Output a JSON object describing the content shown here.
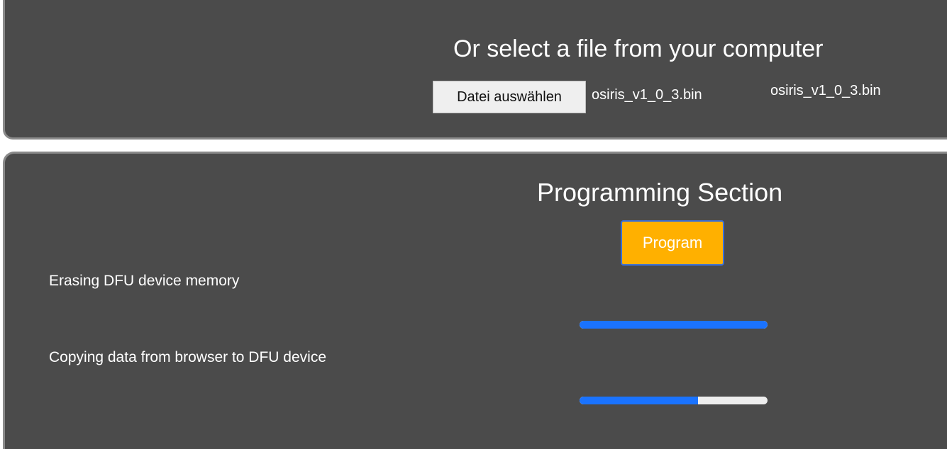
{
  "file_section": {
    "title": "Or select a file from your computer",
    "choose_button_label": "Datei auswählen",
    "selected_file_name": "osiris_v1_0_3.bin",
    "file_label": "osiris_v1_0_3.bin"
  },
  "programming_section": {
    "title": "Programming Section",
    "program_button_label": "Program",
    "erase": {
      "label": "Erasing DFU device memory",
      "progress": 1.0
    },
    "copy": {
      "label": "Copying data from browser to DFU device",
      "progress": 0.63
    }
  },
  "colors": {
    "panel_background": "#4b4b4b",
    "program_button": "#ffb000",
    "progress_fill": "#1a73ff",
    "progress_track": "#eeeeee"
  }
}
